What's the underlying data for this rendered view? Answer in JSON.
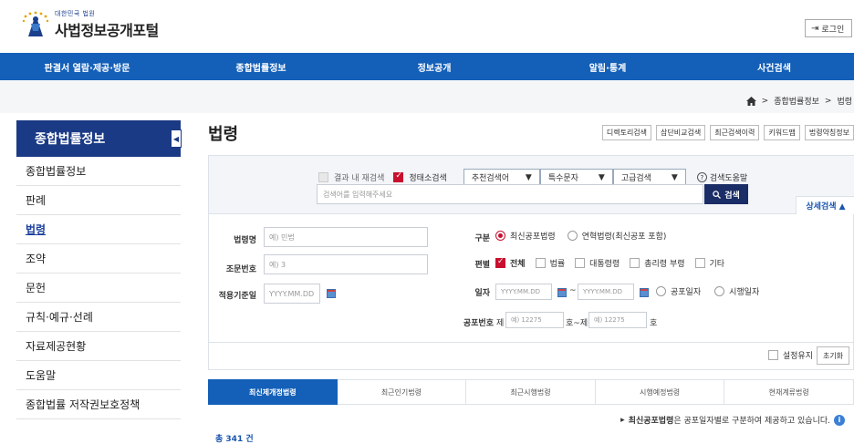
{
  "header": {
    "logo_sub": "대한민국 법원",
    "logo_main": "사법정보공개포털",
    "login_label": "로그인"
  },
  "gnb": [
    "판결서 열람·제공·방문",
    "종합법률정보",
    "정보공개",
    "알림·통계",
    "사건검색"
  ],
  "breadcrumb": [
    "종합법률정보",
    "법령"
  ],
  "sidebar": {
    "title": "종합법률정보",
    "items": [
      "종합법률정보",
      "판례",
      "법령",
      "조약",
      "문헌",
      "규칙·예규·선례",
      "자료제공현황",
      "도움말",
      "종합법률 저작권보호정책"
    ],
    "active_index": 2
  },
  "page_title": "법령",
  "tool_buttons": [
    "디렉토리검색",
    "삼단비교검색",
    "최근검색이력",
    "키워드맵",
    "법령약칭정보"
  ],
  "search": {
    "within_label": "결과 내 재검색",
    "precise_label": "정태소검색",
    "dropdowns": [
      "추천검색어",
      "특수문자",
      "고급검색"
    ],
    "help_label": "검색도움말",
    "placeholder": "검색어를 입력해주세요",
    "button_label": "검색",
    "detail_label": "상세검색 ▲"
  },
  "detail": {
    "name_label": "법령명",
    "name_placeholder": "예) 민법",
    "article_label": "조문번호",
    "article_placeholder": "예) 3",
    "apply_label": "적용기준일",
    "date_placeholder": "YYYY.MM.DD",
    "type_label": "구분",
    "type_options": [
      "최신공포법령",
      "연혁법령(최신공포 포함)"
    ],
    "category_label": "편별",
    "category_options": [
      "전체",
      "법률",
      "대통령령",
      "총리령 부령",
      "기타"
    ],
    "date_label": "일자",
    "date_sep": "~",
    "date_radio": [
      "공포일자",
      "시행일자"
    ],
    "promul_label": "공포번호",
    "promul_prefix": "제",
    "promul_placeholder": "예) 12275",
    "promul_mid": "호~제",
    "promul_suffix": "호",
    "keep_label": "설정유지",
    "reset_label": "초기화"
  },
  "tabs": [
    "최신제개정법령",
    "최근인기법령",
    "최근시행법령",
    "시행예정법령",
    "현재계류법령"
  ],
  "notice_bold": "최신공포법령",
  "notice_rest": "은 공포일자별로 구분하여 제공하고 있습니다.",
  "total_label": "총 341 건",
  "colors": {
    "brand_blue": "#1460b8",
    "sidebar_navy": "#1b3a86",
    "check_red": "#c8102e"
  }
}
